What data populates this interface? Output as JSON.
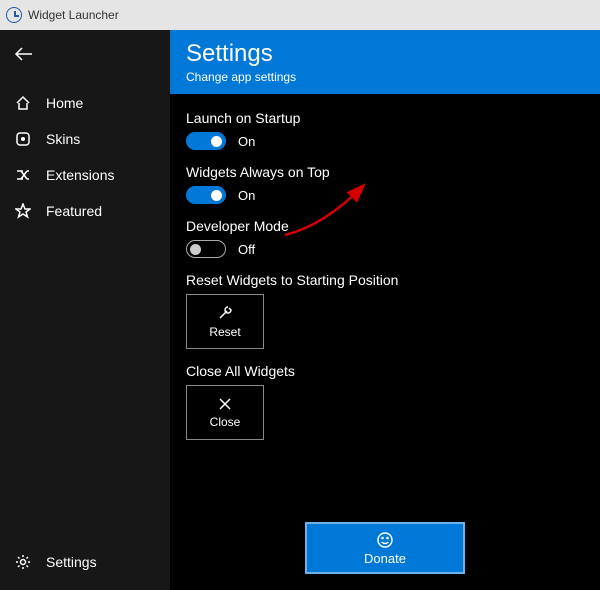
{
  "titlebar": {
    "title": "Widget Launcher"
  },
  "sidebar": {
    "items": [
      {
        "label": "Home",
        "icon": "home-icon"
      },
      {
        "label": "Skins",
        "icon": "skins-icon"
      },
      {
        "label": "Extensions",
        "icon": "extensions-icon"
      },
      {
        "label": "Featured",
        "icon": "star-icon"
      }
    ],
    "settings_label": "Settings"
  },
  "header": {
    "title": "Settings",
    "subtitle": "Change app settings"
  },
  "settings": {
    "launch_startup": {
      "label": "Launch on Startup",
      "state": "On",
      "on": true
    },
    "always_on_top": {
      "label": "Widgets Always on Top",
      "state": "On",
      "on": true
    },
    "developer_mode": {
      "label": "Developer Mode",
      "state": "Off",
      "on": false
    },
    "reset": {
      "label": "Reset Widgets to Starting Position",
      "button": "Reset"
    },
    "close": {
      "label": "Close All Widgets",
      "button": "Close"
    }
  },
  "donate": {
    "label": "Donate"
  }
}
